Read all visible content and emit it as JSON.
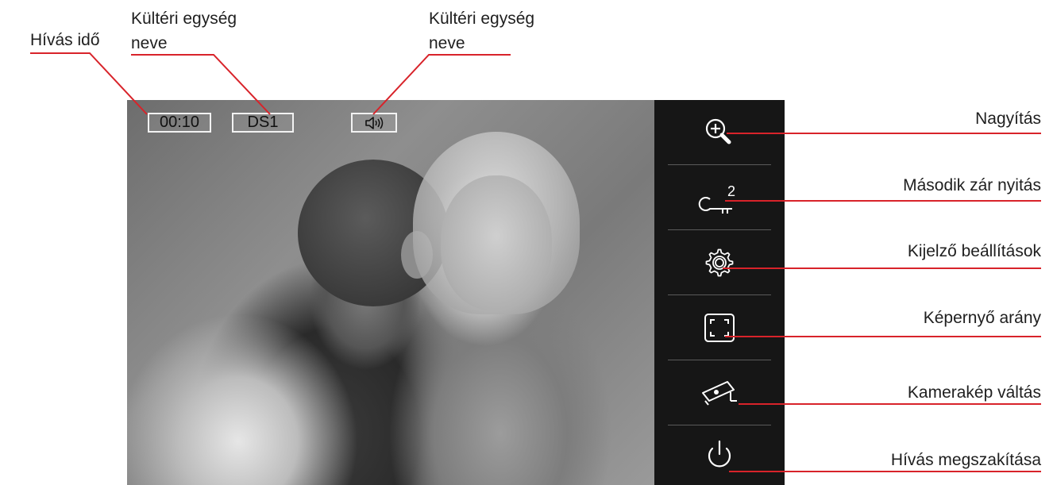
{
  "annotations": {
    "call_time": "Hívás idő",
    "outdoor_unit_name_1": [
      "Kültéri egység",
      "neve"
    ],
    "outdoor_unit_name_2": [
      "Kültéri egység",
      "neve"
    ],
    "zoom": "Nagyítás",
    "second_lock": "Második zár nyitás",
    "display_settings": "Kijelző beállítások",
    "aspect_ratio": "Képernyő arány",
    "camera_switch": "Kamerakép váltás",
    "hang_up": "Hívás megszakítása"
  },
  "screen": {
    "call_timer": "00:10",
    "unit_name": "DS1",
    "speaker_icon": "speaker-icon"
  },
  "panel": {
    "buttons": [
      {
        "icon": "zoom-in-icon"
      },
      {
        "icon": "key-icon",
        "badge": "2"
      },
      {
        "icon": "gear-icon"
      },
      {
        "icon": "aspect-ratio-icon"
      },
      {
        "icon": "camera-switch-icon"
      },
      {
        "icon": "power-icon"
      }
    ]
  },
  "colors": {
    "callout_line": "#d8232a",
    "panel_bg": "#161616",
    "panel_icon": "#ffffff"
  }
}
